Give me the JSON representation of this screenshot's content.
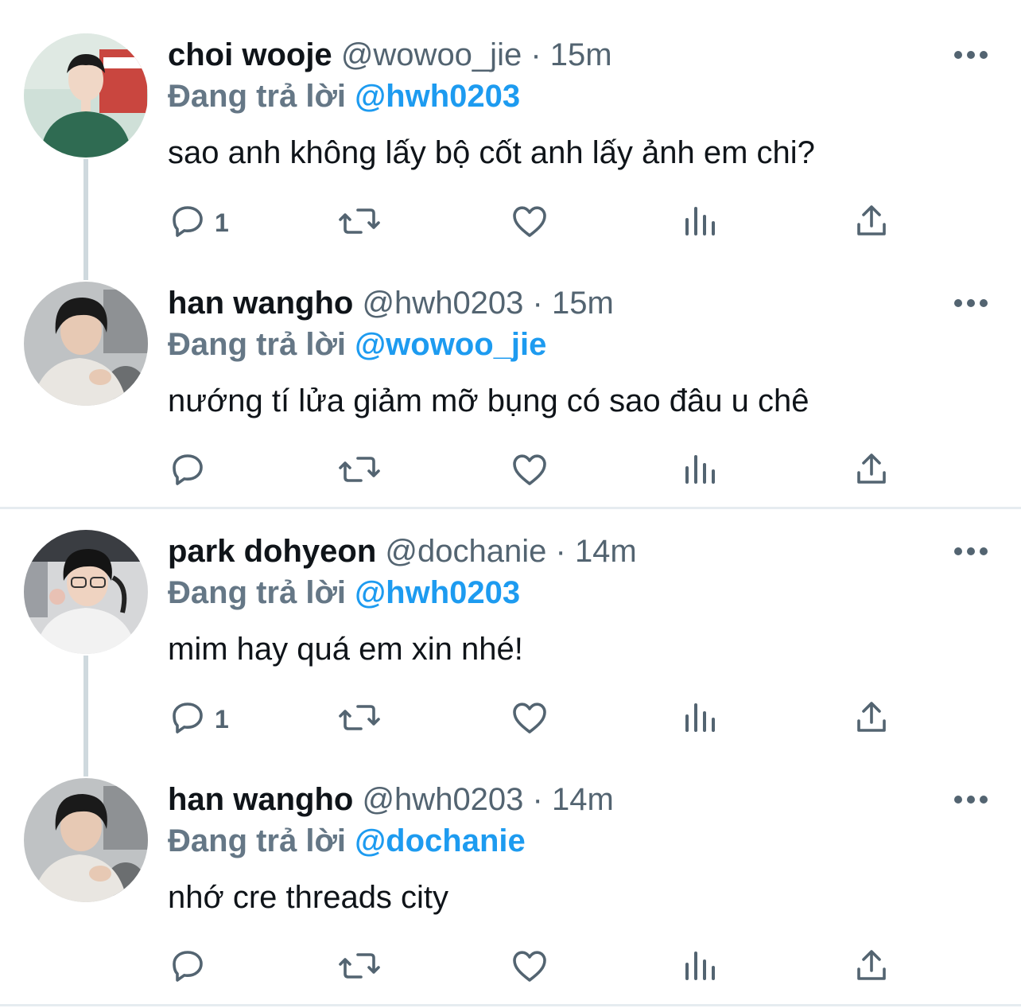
{
  "tweets": [
    {
      "name": "choi wooje",
      "handle": "@wowoo_jie",
      "dot": "·",
      "time": "15m",
      "reply_label": "Đang trả lời",
      "reply_to": "@hwh0203",
      "text": "sao anh không lấy bộ cốt anh lấy ảnh em chi?",
      "reply_count": "1",
      "avatar": "avatar-choi-wooje"
    },
    {
      "name": "han wangho",
      "handle": "@hwh0203",
      "dot": "·",
      "time": "15m",
      "reply_label": "Đang trả lời",
      "reply_to": "@wowoo_jie",
      "text": "nướng tí lửa giảm mỡ bụng có sao đâu u chê",
      "reply_count": "",
      "avatar": "avatar-han-wangho"
    },
    {
      "name": "park dohyeon",
      "handle": "@dochanie",
      "dot": "·",
      "time": "14m",
      "reply_label": "Đang trả lời",
      "reply_to": "@hwh0203",
      "text": "mim hay quá em xin nhé!",
      "reply_count": "1",
      "avatar": "avatar-park-dohyeon"
    },
    {
      "name": "han wangho",
      "handle": "@hwh0203",
      "dot": "·",
      "time": "14m",
      "reply_label": "Đang trả lời",
      "reply_to": "@dochanie",
      "text": "nhớ cre threads city",
      "reply_count": "",
      "avatar": "avatar-han-wangho"
    }
  ],
  "icons": {
    "reply": "reply-icon",
    "retweet": "retweet-icon",
    "like": "heart-icon",
    "views": "views-icon",
    "share": "share-icon",
    "more": "more-icon"
  },
  "colors": {
    "link": "#1d9bf0",
    "muted": "#536471",
    "text": "#0f1419",
    "thread_line": "#cfd9de"
  }
}
